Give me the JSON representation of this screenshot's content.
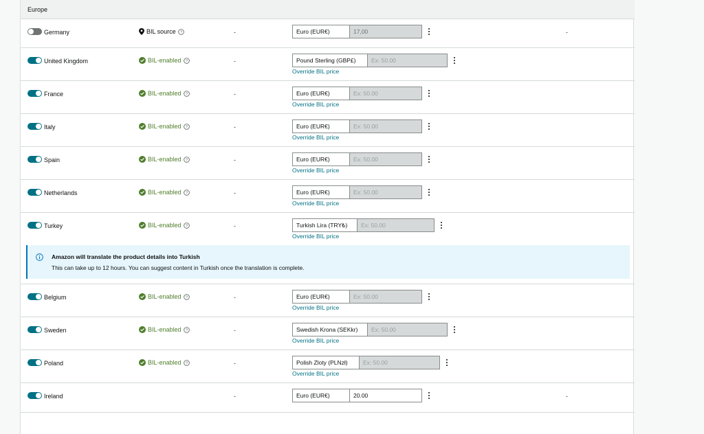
{
  "section": {
    "title": "Europe"
  },
  "columns": {
    "placeholder_dash": "-"
  },
  "rows": [
    {
      "country": "Germany",
      "enabled": false,
      "status": "BIL source",
      "status_type": "source",
      "currency": "Euro (EUR€)",
      "price": "17,00",
      "override_link": "",
      "trailing_dash": "-"
    },
    {
      "country": "United Kingdom",
      "enabled": true,
      "status": "BIL-enabled",
      "status_type": "enabled",
      "currency": "Pound Sterling (GBP£)",
      "price_placeholder": "Ex: 50.00",
      "override_link": "Override BIL price"
    },
    {
      "country": "France",
      "enabled": true,
      "status": "BIL-enabled",
      "status_type": "enabled",
      "currency": "Euro (EUR€)",
      "price_placeholder": "Ex: 50.00",
      "override_link": "Override BIL price"
    },
    {
      "country": "Italy",
      "enabled": true,
      "status": "BIL-enabled",
      "status_type": "enabled",
      "currency": "Euro (EUR€)",
      "price_placeholder": "Ex: 50.00",
      "override_link": "Override BIL price"
    },
    {
      "country": "Spain",
      "enabled": true,
      "status": "BIL-enabled",
      "status_type": "enabled",
      "currency": "Euro (EUR€)",
      "price_placeholder": "Ex: 50.00",
      "override_link": "Override BIL price"
    },
    {
      "country": "Netherlands",
      "enabled": true,
      "status": "BIL-enabled",
      "status_type": "enabled",
      "currency": "Euro (EUR€)",
      "price_placeholder": "Ex: 50.00",
      "override_link": "Override BIL price"
    },
    {
      "country": "Turkey",
      "enabled": true,
      "status": "BIL-enabled",
      "status_type": "enabled",
      "currency": "Turkish Lira (TRY₺)",
      "price_placeholder": "Ex: 50.00",
      "override_link": "Override BIL price"
    },
    {
      "country": "Belgium",
      "enabled": true,
      "status": "BIL-enabled",
      "status_type": "enabled",
      "currency": "Euro (EUR€)",
      "price_placeholder": "Ex: 50.00",
      "override_link": "Override BIL price"
    },
    {
      "country": "Sweden",
      "enabled": true,
      "status": "BIL-enabled",
      "status_type": "enabled",
      "currency": "Swedish Krona (SEKkr)",
      "price_placeholder": "Ex: 50.00",
      "override_link": "Override BIL price"
    },
    {
      "country": "Poland",
      "enabled": true,
      "status": "BIL-enabled",
      "status_type": "enabled",
      "currency": "Polish Zloty (PLNzł)",
      "price_placeholder": "Ex: 50.00",
      "override_link": "Override BIL price"
    },
    {
      "country": "Ireland",
      "enabled": true,
      "status": "",
      "status_type": "none",
      "currency": "Euro (EUR€)",
      "price": "20.00",
      "override_link": "",
      "trailing_dash": "-"
    }
  ],
  "info": {
    "title": "Amazon will translate the product details into Turkish",
    "body": "This can take up to 12 hours. You can suggest content in Turkish once the translation is complete."
  },
  "colors": {
    "accent": "#007185",
    "success": "#507e2c",
    "info_bg": "#e6f6fc"
  }
}
